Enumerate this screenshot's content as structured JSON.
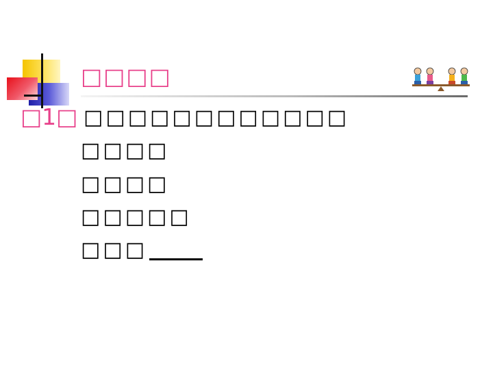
{
  "slide": {
    "title": "□□□□",
    "question_number": "□1□",
    "question_text": "□□□□□□□□□□□□",
    "options": [
      "□□□□",
      "□□□□",
      "□□□□□",
      "□□□"
    ],
    "answer_blank": ""
  },
  "colors": {
    "accent_pink": "#e8418b",
    "deco_yellow": "#f5c400",
    "deco_blue": "#1f1fa8",
    "deco_red": "#e8101a"
  },
  "icons": {
    "corner_decoration": "color-squares-decoration",
    "header_graphic": "children-on-seesaw-clipart"
  }
}
